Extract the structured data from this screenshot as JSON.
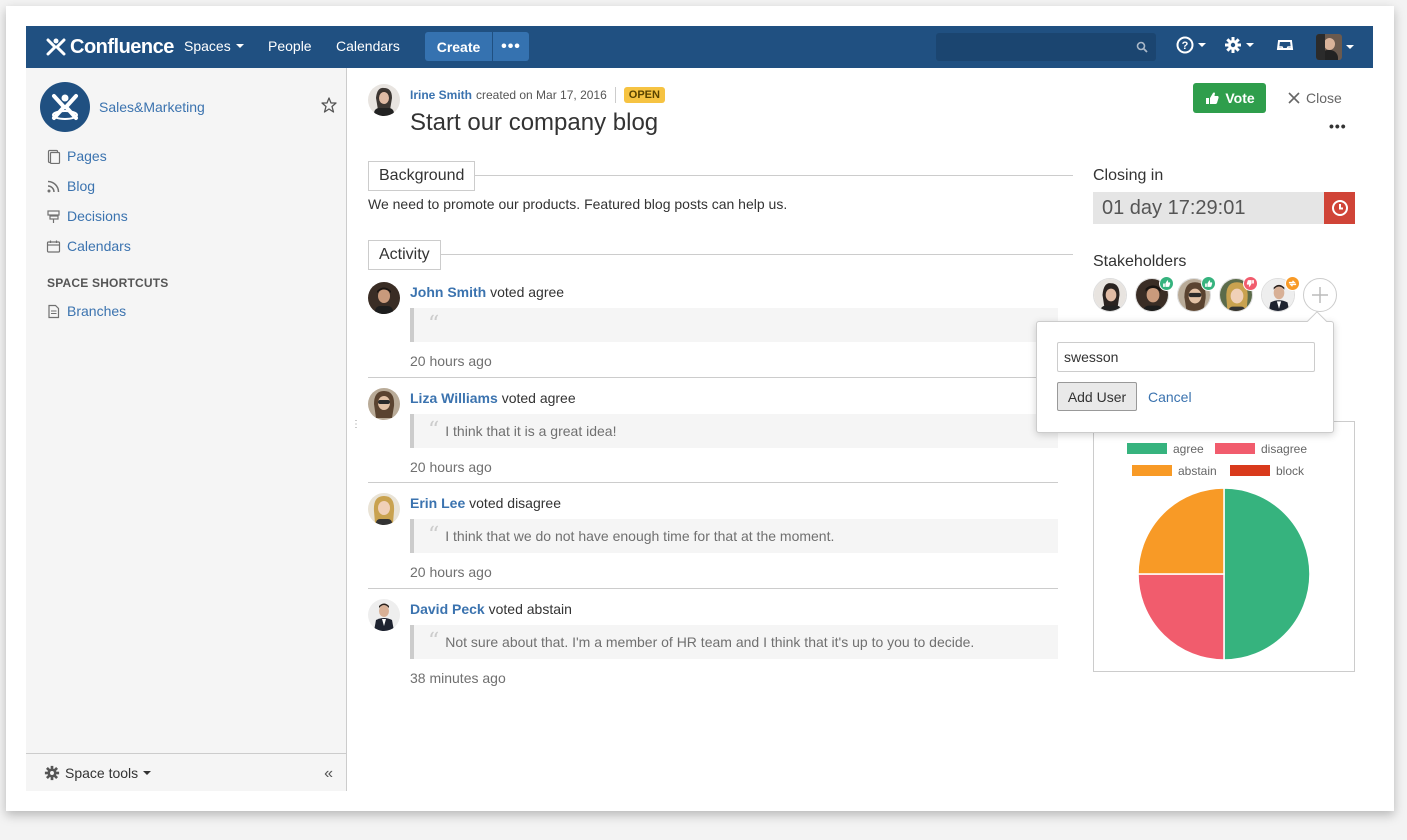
{
  "header": {
    "logo_text": "Confluence",
    "nav": {
      "spaces": "Spaces",
      "people": "People",
      "calendars": "Calendars"
    },
    "create_label": "Create",
    "more_label": "•••",
    "search_placeholder": ""
  },
  "sidebar": {
    "space_name": "Sales&Marketing",
    "items": [
      {
        "label": "Pages",
        "icon": "pages-icon"
      },
      {
        "label": "Blog",
        "icon": "rss-icon"
      },
      {
        "label": "Decisions",
        "icon": "decisions-icon"
      },
      {
        "label": "Calendars",
        "icon": "calendar-icon"
      }
    ],
    "shortcuts_heading": "SPACE SHORTCUTS",
    "shortcuts": [
      {
        "label": "Branches",
        "icon": "page-icon"
      }
    ],
    "space_tools": "Space tools",
    "collapse_label": "«"
  },
  "decision": {
    "author": "Irine Smith",
    "created_text": "created on Mar 17, 2016",
    "status": "OPEN",
    "title": "Start our company blog",
    "vote_label": "Vote",
    "close_label": "Close",
    "more_label": "•••"
  },
  "background": {
    "heading": "Background",
    "text": "We need to promote our products. Featured blog posts can help us."
  },
  "activity": {
    "heading": "Activity",
    "entries": [
      {
        "user": "John Smith",
        "action": "voted agree",
        "comment": "",
        "time": "20 hours ago"
      },
      {
        "user": "Liza Williams",
        "action": "voted agree",
        "comment": "I think that it is a great idea!",
        "time": "20 hours ago"
      },
      {
        "user": "Erin Lee",
        "action": "voted disagree",
        "comment": "I think that we do not have enough time for that at the moment.",
        "time": "20 hours ago"
      },
      {
        "user": "David Peck",
        "action": "voted abstain",
        "comment": "Not sure about that. I'm a member of HR team and I think that it's up to you to decide.",
        "time": "38 minutes ago"
      }
    ]
  },
  "closing": {
    "label": "Closing in",
    "countdown": "01 day 17:29:01"
  },
  "stakeholders": {
    "label": "Stakeholders",
    "badges": [
      "none",
      "agree",
      "agree",
      "disagree",
      "abstain"
    ]
  },
  "add_user_popup": {
    "input_value": "swesson",
    "add_label": "Add User",
    "cancel_label": "Cancel"
  },
  "colors": {
    "header": "#205081",
    "agree": "#36b37e",
    "disagree": "#f15c6d",
    "abstain": "#f89a26",
    "block": "#d93a1c",
    "link": "#3b73af"
  },
  "chart_data": {
    "type": "pie",
    "legend": [
      "agree",
      "disagree",
      "abstain",
      "block"
    ],
    "values": [
      2,
      1,
      1,
      0
    ],
    "colors": [
      "#36b37e",
      "#f15c6d",
      "#f89a26",
      "#d93a1c"
    ]
  }
}
